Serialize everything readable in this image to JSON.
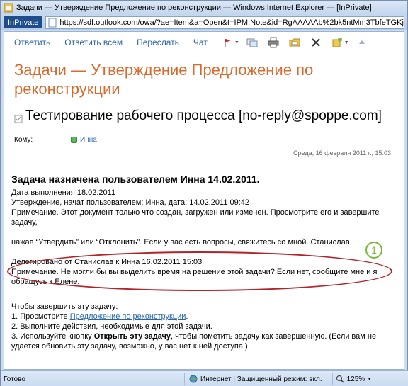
{
  "window": {
    "title": "Задачи — Утверждение Предложение по реконструкции — Windows Internet Explorer — [InPrivate]"
  },
  "addressbar": {
    "inprivate_label": "InPrivate",
    "url": "https://sdf.outlook.com/owa/?ae=Item&a=Open&t=IPM.Note&id=RgAAAAAb%2bk5ntMm3TbfeTGKj6KZRBwDFtt1A\\"
  },
  "toolbar": {
    "reply": "Ответить",
    "reply_all": "Ответить всем",
    "forward": "Переслать",
    "chat": "Чат",
    "icons": [
      "flag-icon",
      "categories-icon",
      "print-icon",
      "move-icon",
      "delete-icon",
      "options-icon",
      "up-icon"
    ]
  },
  "item": {
    "title": "Задачи — Утверждение Предложение по реконструкции",
    "subject": "Тестирование рабочего процесса [no-reply@spoppe.com]",
    "to_label": "Кому:",
    "recipient": "Инна",
    "date": "Среда, 16 февраля 2011 г., 15:03"
  },
  "body": {
    "heading": "Задача назначена пользователем Инна 14.02.2011.",
    "due_date": "Дата выполнения 18.02.2011",
    "workflow_started": "Утверждение, начат пользователем: Инна, дата: 14.02.2011 09:42",
    "note": "Примечание. Этот документ только что создан, загружен или изменен. Просмотрите его и завершите задачу,",
    "instruction": "нажав “Утвердить” или “Отклонить”. Если у вас есть вопросы, свяжитесь со мной. Станислав",
    "delegated": "Делегировано от Станислав к Инна 16.02.2011 15:03",
    "delegated_note": "Примечание. Не могли бы вы выделить время на решение этой задачи? Если нет, сообщите мне и я обращусь к Елене.",
    "callout_number": "1",
    "complete_intro": "Чтобы завершить эту задачу:",
    "step1_prefix": "1. Просмотрите ",
    "step1_link": "Предложение по реконструкции",
    "step1_suffix": ".",
    "step2": "2. Выполните действия, необходимые для этой задачи.",
    "step3_prefix": "3. Используйте кнопку ",
    "step3_bold": "Открыть эту задачу",
    "step3_suffix": ", чтобы пометить задачу как завершенную. (Если вам не удается обновить эту задачу, возможно, у вас нет к ней доступа.)"
  },
  "statusbar": {
    "status": "Готово",
    "zone": "Интернет | Защищенный режим: вкл.",
    "zoom": "125%"
  },
  "colors": {
    "title_orange": "#d86a2e",
    "link_blue": "#2966a8",
    "callout_red": "#b0242a",
    "marker_green": "#7bb83a"
  }
}
